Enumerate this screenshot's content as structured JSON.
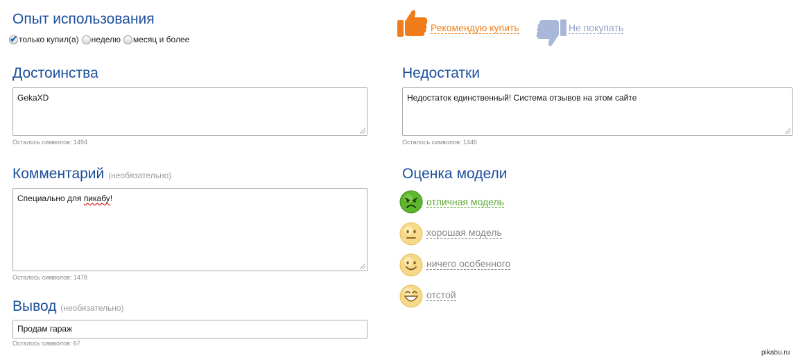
{
  "experience": {
    "title": "Опыт использования",
    "options": [
      {
        "label": "только купил(а)",
        "selected": true
      },
      {
        "label": "неделю",
        "selected": false
      },
      {
        "label": "месяц и более",
        "selected": false
      }
    ]
  },
  "recommend": {
    "yes_label": "Рекомендую купить",
    "no_label": "Не покупать",
    "yes_color": "#f07d1a",
    "no_color": "#8fa3c8"
  },
  "pros": {
    "title": "Достоинства",
    "value": "GekaXD",
    "remaining": "Осталось символов: 1494"
  },
  "cons": {
    "title": "Недостатки",
    "value": "Недостаток единственный! Система отзывов на этом сайте",
    "remaining": "Осталось символов: 1446"
  },
  "comment": {
    "title": "Комментарий",
    "optional": "(необязательно)",
    "value_before": "Специально для ",
    "value_misspelled": "пикабу",
    "value_after": "!",
    "remaining": "Осталось символов: 1478"
  },
  "conclusion": {
    "title": "Вывод",
    "optional": "(необязательно)",
    "value": "Продам гараж",
    "remaining": "Осталось символов: 67"
  },
  "rating": {
    "title": "Оценка модели",
    "options": [
      {
        "label": "отличная модель",
        "icon": "angry-green-smiley-icon",
        "color": "#5aa830"
      },
      {
        "label": "хорошая модель",
        "icon": "neutral-smiley-icon",
        "color": "#888888"
      },
      {
        "label": "ничего особенного",
        "icon": "smile-smiley-icon",
        "color": "#888888"
      },
      {
        "label": "отстой",
        "icon": "grin-smiley-icon",
        "color": "#888888"
      }
    ]
  },
  "watermark": "pikabu.ru"
}
